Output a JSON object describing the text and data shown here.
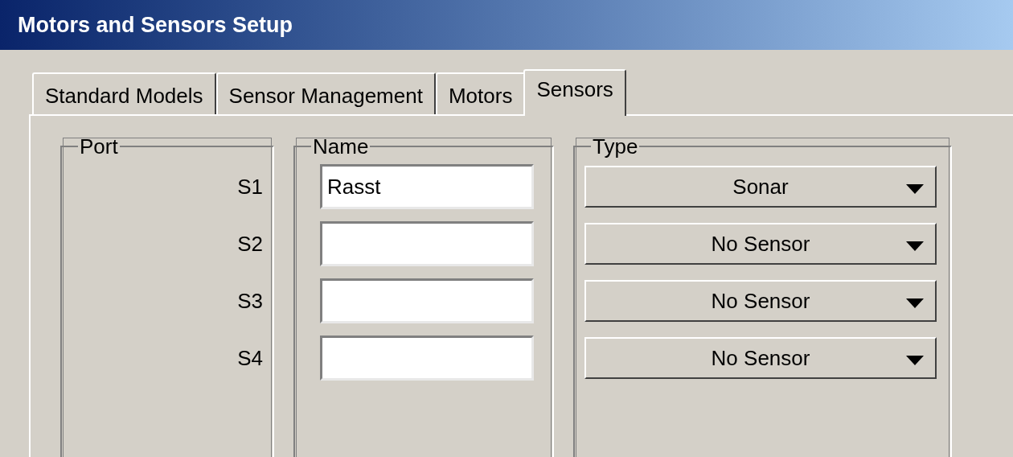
{
  "window": {
    "title": "Motors and Sensors Setup"
  },
  "tabs": [
    {
      "label": "Standard Models",
      "selected": false
    },
    {
      "label": "Sensor Management",
      "selected": false
    },
    {
      "label": "Motors",
      "selected": false
    },
    {
      "label": "Sensors",
      "selected": true
    }
  ],
  "groups": {
    "port": "Port",
    "name": "Name",
    "type": "Type"
  },
  "sensors": [
    {
      "port": "S1",
      "name": "Rasst",
      "type": "Sonar"
    },
    {
      "port": "S2",
      "type": "No Sensor"
    },
    {
      "port": "S3",
      "type": "No Sensor"
    },
    {
      "port": "S4",
      "type": "No Sensor"
    }
  ]
}
